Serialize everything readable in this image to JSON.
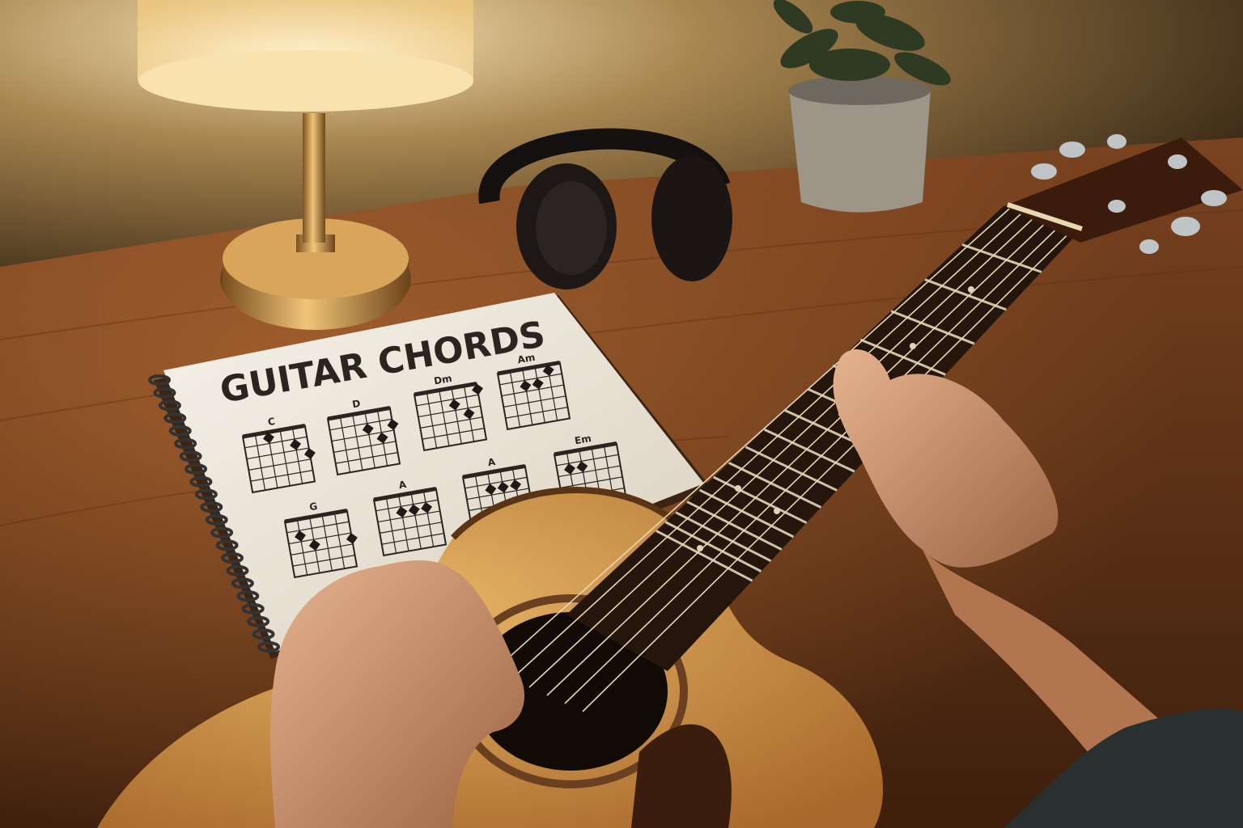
{
  "notebook": {
    "title": "GUITAR CHORDS",
    "chords_row1": [
      {
        "name": "C",
        "dots": [
          [
            2,
            1
          ],
          [
            4,
            2
          ],
          [
            5,
            3
          ]
        ]
      },
      {
        "name": "D",
        "dots": [
          [
            3,
            2
          ],
          [
            4,
            3
          ],
          [
            5,
            2
          ]
        ]
      },
      {
        "name": "Dm",
        "dots": [
          [
            3,
            2
          ],
          [
            4,
            3
          ],
          [
            5,
            1
          ]
        ]
      },
      {
        "name": "Am",
        "dots": [
          [
            2,
            2
          ],
          [
            3,
            2
          ],
          [
            4,
            1
          ]
        ]
      }
    ],
    "chords_row2": [
      {
        "name": "G",
        "dots": [
          [
            1,
            2
          ],
          [
            2,
            3
          ],
          [
            5,
            3
          ]
        ]
      },
      {
        "name": "A",
        "dots": [
          [
            2,
            2
          ],
          [
            3,
            2
          ],
          [
            4,
            2
          ]
        ]
      },
      {
        "name": "A",
        "dots": [
          [
            2,
            2
          ],
          [
            3,
            2
          ],
          [
            4,
            2
          ]
        ]
      },
      {
        "name": "Em",
        "dots": [
          [
            1,
            2
          ],
          [
            2,
            2
          ]
        ]
      }
    ]
  },
  "colors": {
    "desk": "#6b3a17",
    "wall": "#5a4327",
    "lamp_shade": "#f5dfae",
    "lamp_brass": "#c8934a",
    "guitar_top": "#d29a4e",
    "fretboard": "#2a1a10",
    "skin": "#d9a07a",
    "paper": "#f1ece2"
  }
}
